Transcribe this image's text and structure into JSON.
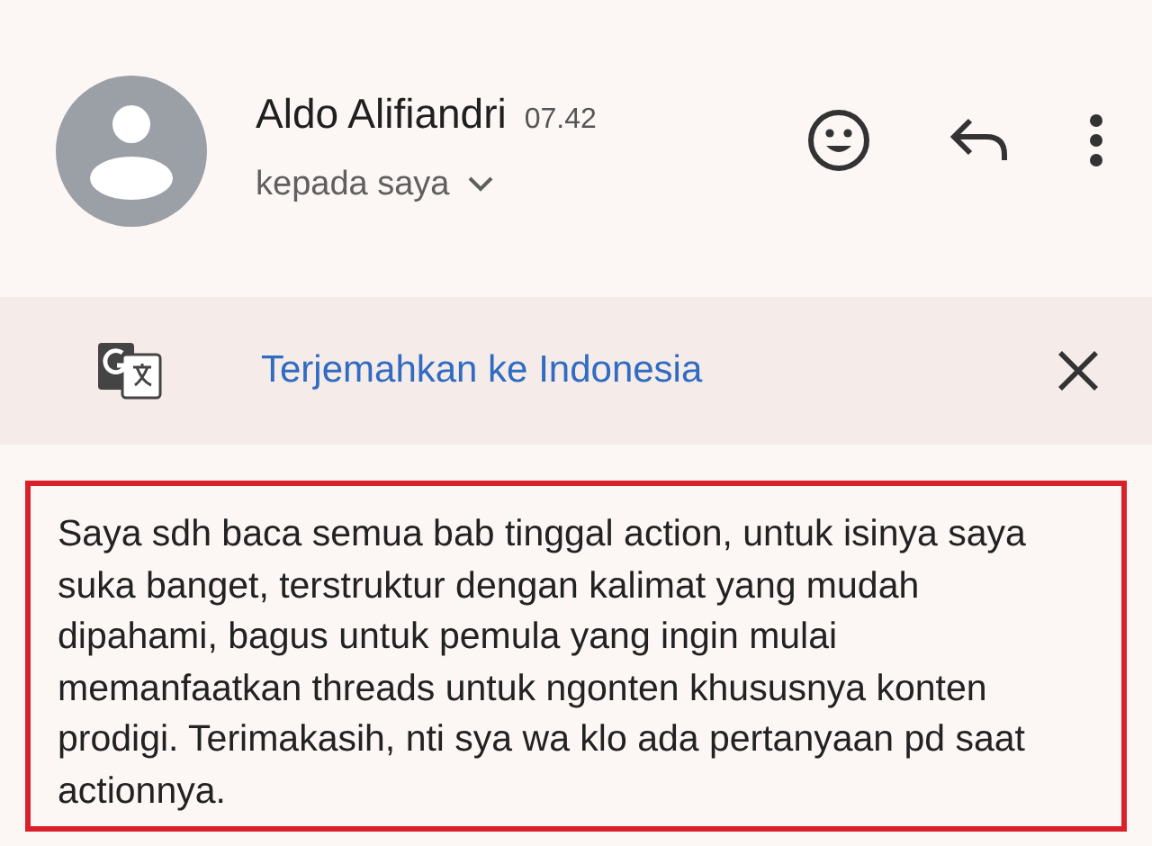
{
  "sender": {
    "name": "Aldo Alifiandri",
    "time": "07.42",
    "recipient": "kepada saya"
  },
  "translate_bar": {
    "link": "Terjemahkan ke Indonesia"
  },
  "message": {
    "body": "Saya sdh baca semua bab tinggal action, untuk isinya saya suka banget, terstruktur dengan kalimat yang mudah dipahami, bagus untuk pemula yang ingin mulai memanfaatkan threads untuk ngonten khususnya konten prodigi. Terimakasih, nti sya wa klo ada pertanyaan pd saat actionnya.",
    "highlighted": true
  }
}
